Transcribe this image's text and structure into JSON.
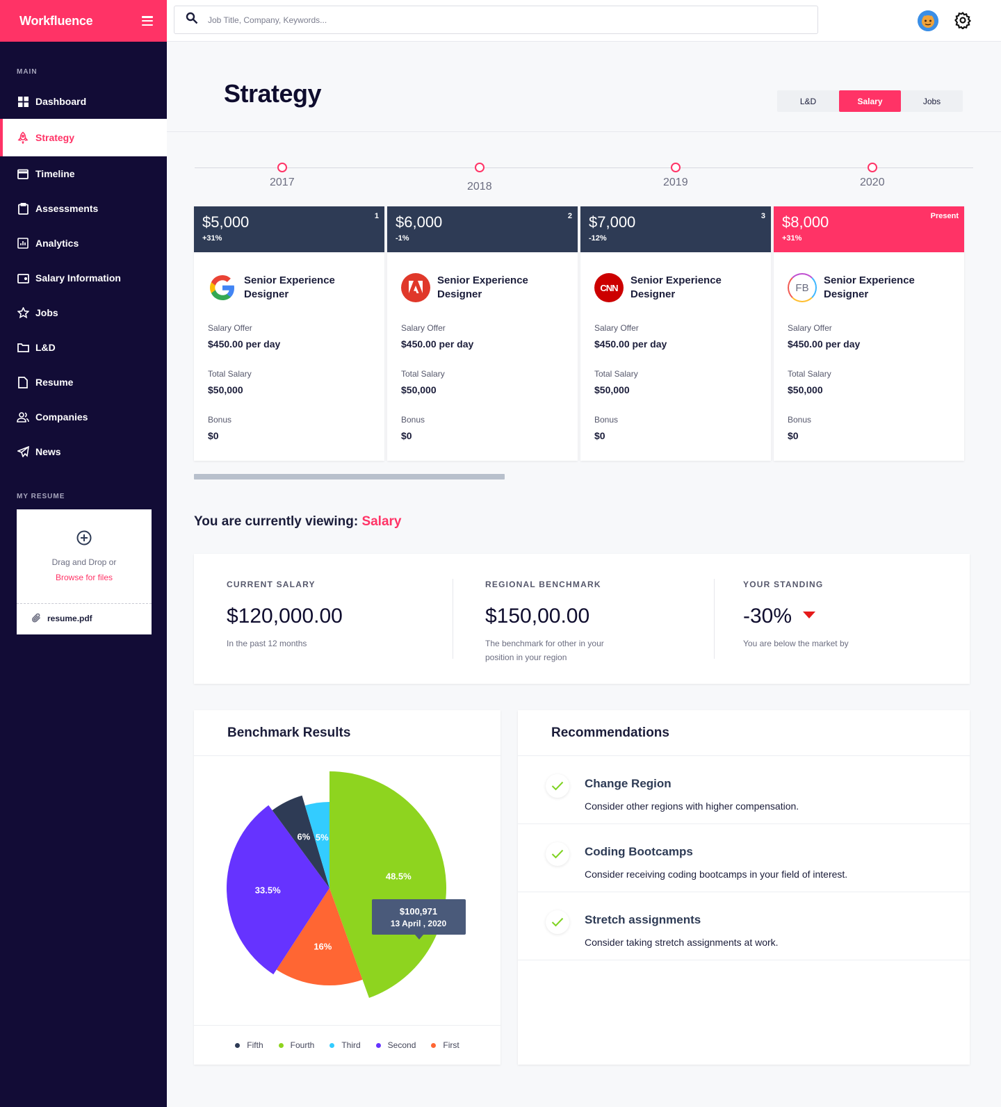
{
  "brand": {
    "name": "Workfluence"
  },
  "search": {
    "placeholder": "Job Title, Company, Keywords..."
  },
  "sidebar": {
    "main_label": "MAIN",
    "items": [
      {
        "label": "Dashboard",
        "icon": "grid-icon"
      },
      {
        "label": "Strategy",
        "icon": "rocket-icon",
        "active": true
      },
      {
        "label": "Timeline",
        "icon": "calendar-icon"
      },
      {
        "label": "Assessments",
        "icon": "clipboard-icon"
      },
      {
        "label": "Analytics",
        "icon": "chart-icon"
      },
      {
        "label": "Salary Information",
        "icon": "wallet-icon"
      },
      {
        "label": "Jobs",
        "icon": "star-icon"
      },
      {
        "label": "L&D",
        "icon": "folder-icon"
      },
      {
        "label": "Resume",
        "icon": "file-icon"
      },
      {
        "label": "Companies",
        "icon": "users-icon"
      },
      {
        "label": "News",
        "icon": "send-icon"
      }
    ],
    "resume_label": "MY RESUME",
    "upload": {
      "text": "Drag and Drop or",
      "link": "Browse for files",
      "file": "resume.pdf"
    }
  },
  "page": {
    "title": "Strategy"
  },
  "tabs": [
    "L&D",
    "Salary",
    "Jobs"
  ],
  "active_tab": "Salary",
  "timeline": {
    "years": [
      "2017",
      "2018",
      "2019",
      "2020"
    ]
  },
  "cards": [
    {
      "amount": "$5,000",
      "change": "+31%",
      "tag": "1",
      "company": "Google",
      "logo": "google-logo",
      "title": "Senior Experience Designer",
      "offer_label": "Salary Offer",
      "offer": "$450.00 per day",
      "total_label": "Total Salary",
      "total": "$50,000",
      "bonus_label": "Bonus",
      "bonus": "$0"
    },
    {
      "amount": "$6,000",
      "change": "-1%",
      "tag": "2",
      "company": "Adobe",
      "logo": "adobe-logo",
      "title": "Senior Experience Designer",
      "offer_label": "Salary Offer",
      "offer": "$450.00 per day",
      "total_label": "Total Salary",
      "total": "$50,000",
      "bonus_label": "Bonus",
      "bonus": "$0"
    },
    {
      "amount": "$7,000",
      "change": "-12%",
      "tag": "3",
      "company": "CNN",
      "logo": "cnn-logo",
      "logo_text": "CNN",
      "title": "Senior Experience Designer",
      "offer_label": "Salary Offer",
      "offer": "$450.00 per day",
      "total_label": "Total Salary",
      "total": "$50,000",
      "bonus_label": "Bonus",
      "bonus": "$0"
    },
    {
      "amount": "$8,000",
      "change": "+31%",
      "tag": "Present",
      "company": "FB",
      "logo": "fb-logo",
      "logo_text": "FB",
      "title": "Senior Experience Designer",
      "offer_label": "Salary Offer",
      "offer": "$450.00 per day",
      "total_label": "Total Salary",
      "total": "$50,000",
      "bonus_label": "Bonus",
      "bonus": "$0"
    }
  ],
  "viewing": {
    "prefix": "You are currently viewing:",
    "value": "Salary"
  },
  "stats": [
    {
      "label": "CURRENT SALARY",
      "value": "$120,000.00",
      "sub": "In the past 12 months"
    },
    {
      "label": "REGIONAL BENCHMARK",
      "value": "$150,00.00",
      "sub": "The benchmark for other in your position in your region"
    },
    {
      "label": "YOUR STANDING",
      "value": "-30%",
      "sub": "You are below the market by",
      "trend": "down"
    }
  ],
  "benchmark": {
    "title": "Benchmark Results"
  },
  "chart_data": {
    "type": "pie",
    "title": "Benchmark Results",
    "slices": [
      {
        "name": "Fourth",
        "value": 48.5,
        "label": "48.5%",
        "color": "#8ed41f"
      },
      {
        "name": "First",
        "value": 16,
        "label": "16%",
        "color": "#ff6633"
      },
      {
        "name": "Second",
        "value": 33.5,
        "label": "33.5%",
        "color": "#6633ff"
      },
      {
        "name": "Fifth",
        "value": 6,
        "label": "6%",
        "color": "#2e3b55"
      },
      {
        "name": "Third",
        "value": 5,
        "label": "5%",
        "color": "#33ccff"
      }
    ],
    "legend": [
      {
        "name": "Fifth",
        "color": "#2e3b55"
      },
      {
        "name": "Fourth",
        "color": "#8ed41f"
      },
      {
        "name": "Third",
        "color": "#33ccff"
      },
      {
        "name": "Second",
        "color": "#6633ff"
      },
      {
        "name": "First",
        "color": "#ff6633"
      }
    ],
    "legend_position": "bottom",
    "tooltip": {
      "value": "$100,971",
      "date": "13 April , 2020"
    }
  },
  "recommendations": {
    "title": "Recommendations",
    "items": [
      {
        "title": "Change Region",
        "desc": "Consider other regions with higher compensation."
      },
      {
        "title": "Coding Bootcamps",
        "desc": "Consider receiving coding bootcamps in your field of interest."
      },
      {
        "title": "Stretch assignments",
        "desc": "Consider taking stretch assignments at work."
      }
    ]
  },
  "colors": {
    "accent": "#ff3366",
    "sidebar": "#120c36",
    "card_header": "#2e3b55",
    "down": "#e51a1a",
    "check": "#7ed321"
  }
}
